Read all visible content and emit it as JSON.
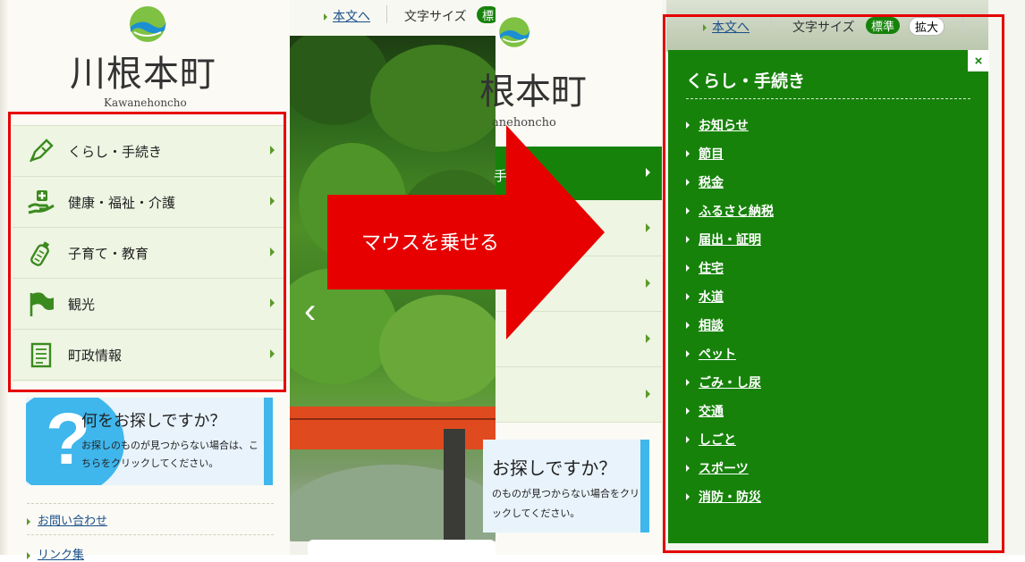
{
  "site": {
    "name": "川根本町",
    "name_romaji": "Kawanehoncho"
  },
  "utility_bar": {
    "skip_link": "本文へ",
    "font_size_label": "文字サイズ",
    "size_standard": "標準",
    "size_large": "拡大",
    "size_standard_partial": "標"
  },
  "left_nav": {
    "items": [
      {
        "label": "くらし・手続き",
        "icon": "pen-icon"
      },
      {
        "label": "健康・福祉・介護",
        "icon": "care-hand-icon"
      },
      {
        "label": "子育て・教育",
        "icon": "baby-bottle-icon"
      },
      {
        "label": "観光",
        "icon": "flag-icon"
      },
      {
        "label": "町政情報",
        "icon": "document-icon"
      }
    ]
  },
  "search_banner": {
    "title": "何をお探しですか？",
    "desc": "お探しのものが見つからない場合は、こちらをクリックしてください。",
    "mid_title": "お探しですか？",
    "mid_desc": "のものが見つからない場合をクリックしてください。"
  },
  "left_links": [
    {
      "label": "お問い合わせ"
    },
    {
      "label": "リンク集"
    }
  ],
  "middle": {
    "title_partial": "根本町",
    "romaji_partial": "anehoncho",
    "active_partial": "手続"
  },
  "annotation": {
    "hover_label": "マウスを乗せる",
    "arrow_color": "#e60000"
  },
  "dropdown": {
    "title": "くらし・手続き",
    "close_symbol": "×",
    "items": [
      "お知らせ",
      "節目",
      "税金",
      "ふるさと納税",
      "届出・証明",
      "住宅",
      "水道",
      "相談",
      "ペット",
      "ごみ・し尿",
      "交通",
      "しごと",
      "スポーツ",
      "消防・防災"
    ]
  },
  "colors": {
    "brand_green": "#16820a",
    "nav_bg": "#eef5e3",
    "highlight_red": "#e60000",
    "search_blue": "#3fb6ec"
  }
}
